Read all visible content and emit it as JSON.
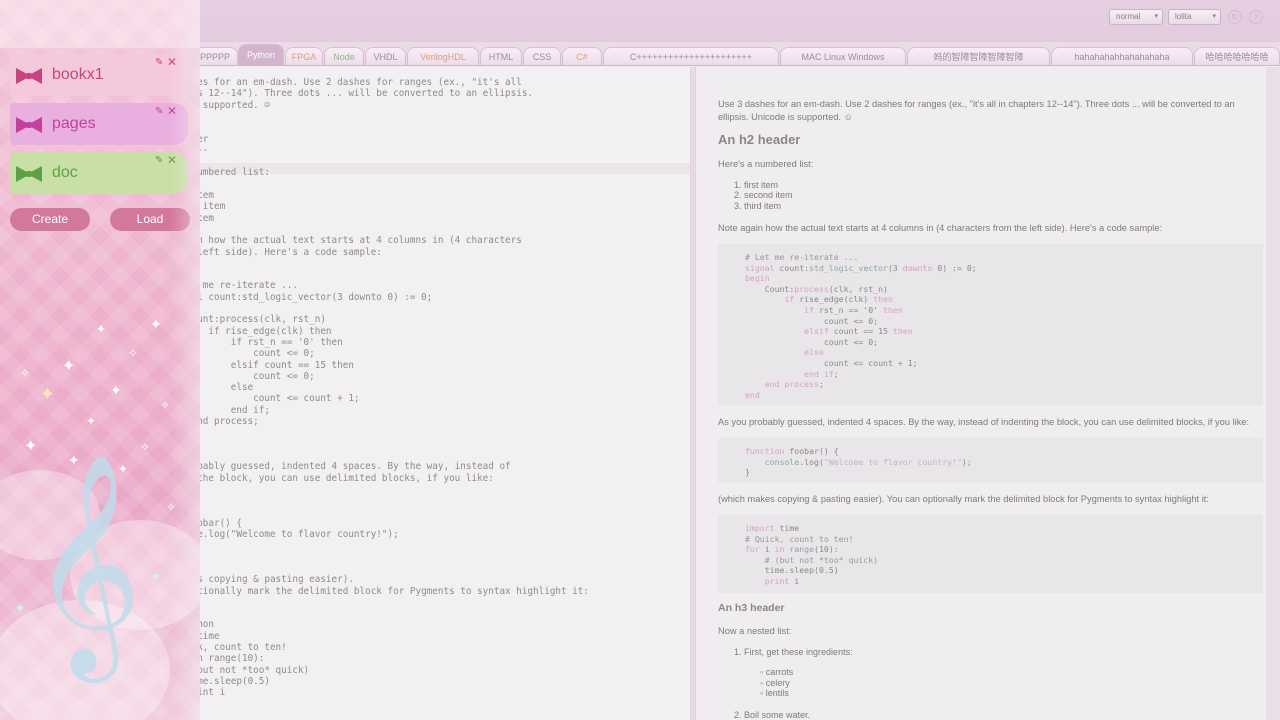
{
  "topbar": {
    "mode_select": "normal",
    "theme_select": "lolita",
    "refresh_icon": "refresh-icon",
    "help_icon": "help-icon"
  },
  "tabs": [
    {
      "label": "PPPPPPP",
      "active": false
    },
    {
      "label": "Python",
      "active": true
    },
    {
      "label": "FPGA",
      "active": false
    },
    {
      "label": "Node",
      "active": false
    },
    {
      "label": "VHDL",
      "active": false
    },
    {
      "label": "VerilogHDL",
      "active": false
    },
    {
      "label": "HTML",
      "active": false
    },
    {
      "label": "CSS",
      "active": false
    },
    {
      "label": "C#",
      "active": false
    },
    {
      "label": "C++++++++++++++++++++++",
      "active": false
    },
    {
      "label": "MAC Linux Windows",
      "active": false
    },
    {
      "label": "妈的智障智障智障智障",
      "active": false
    },
    {
      "label": "hahahahahhahahahaha",
      "active": false
    },
    {
      "label": "哈哈哈哈哈哈哈",
      "active": false
    }
  ],
  "sidebar": {
    "books": [
      {
        "title": "bookx1",
        "color": "#c8437f"
      },
      {
        "title": "pages",
        "color": "#c63f9a"
      },
      {
        "title": "doc",
        "color": "#5fa044"
      }
    ],
    "create_label": "Create",
    "load_label": "Load"
  },
  "editor": {
    "lines": [
      "shes for an em-dash. Use 2 dashes for ranges (ex., \"it's all",
      "ers 12--14\"). Three dots ... will be converted to an ellipsis.",
      "is supported. ☺",
      "",
      "",
      "ader",
      "----",
      "",
      " numbered list:",
      "",
      " item",
      "nd item",
      " item",
      "",
      "ain how the actual text starts at 4 columns in (4 characters",
      "e left side). Here's a code sample:",
      "",
      "",
      "et me re-iterate ...",
      "nal count:std_logic_vector(3 downto 0) := 0;",
      "in",
      "Count:process(clk, rst_n)",
      "    if rise_edge(clk) then",
      "        if rst_n == '0' then",
      "            count <= 0;",
      "        elsif count == 15 then",
      "            count <= 0;",
      "        else",
      "            count <= count + 1;",
      "        end if;",
      " end process;",
      "",
      "",
      "",
      "robably guessed, indented 4 spaces. By the way, instead of",
      "g the block, you can use delimited blocks, if you like:",
      "",
      "",
      "",
      "foobar() {",
      "ole.log(\"Welcome to flavor country!\");",
      "",
      "",
      "",
      "kes copying & pasting easier).",
      "optionally mark the delimited block for Pygments to syntax highlight it:",
      "",
      "",
      "ython",
      "t time",
      "ick, count to ten!",
      " in range(10):",
      " (but not *too* quick)",
      "time.sleep(0.5)",
      "print i"
    ]
  },
  "preview": {
    "intro": "Use 3 dashes for an em-dash. Use 2 dashes for ranges (ex., \"it's all in chapters 12--14\"). Three dots ... will be converted to an ellipsis. Unicode is supported. ☺",
    "h2": "An h2 header",
    "numbered_intro": "Here's a numbered list:",
    "numbered_items": [
      "first item",
      "second item",
      "third item"
    ],
    "code_note": "Note again how the actual text starts at 4 columns in (4 characters from the left side). Here's a code sample:",
    "code1": [
      "# Let me re-iterate ...",
      "signal count:std_logic_vector(3 downto 0) := 0;",
      "begin",
      "    Count:process(clk, rst_n)",
      "        if rise_edge(clk) then",
      "            if rst_n == '0' then",
      "                count <= 0;",
      "            elsif count == 15 then",
      "                count <= 0;",
      "            else",
      "                count <= count + 1;",
      "            end if;",
      "    end process;",
      "end"
    ],
    "indent_note": "As you probably guessed, indented 4 spaces. By the way, instead of indenting the block, you can use delimited blocks, if you like:",
    "code2": [
      "function foobar() {",
      "    console.log(\"Welcome to flavor country!\");",
      "}"
    ],
    "pygments_note": "(which makes copying & pasting easier). You can optionally mark the delimited block for Pygments to syntax highlight it:",
    "code3": [
      "import time",
      "# Quick, count to ten!",
      "for i in range(10):",
      "    # (but not *too* quick)",
      "    time.sleep(0.5)",
      "    print i"
    ],
    "h3": "An h3 header",
    "nested_intro": "Now a nested list:",
    "nested_item1": "First, get these ingredients:",
    "ingredients": [
      "carrots",
      "celery",
      "lentils"
    ],
    "nested_item2": "Boil some water."
  },
  "colors": {
    "sidebar_pink": "#eeb2cd",
    "button_pink": "#d2789c",
    "active_tab": "#d2b4cf"
  }
}
